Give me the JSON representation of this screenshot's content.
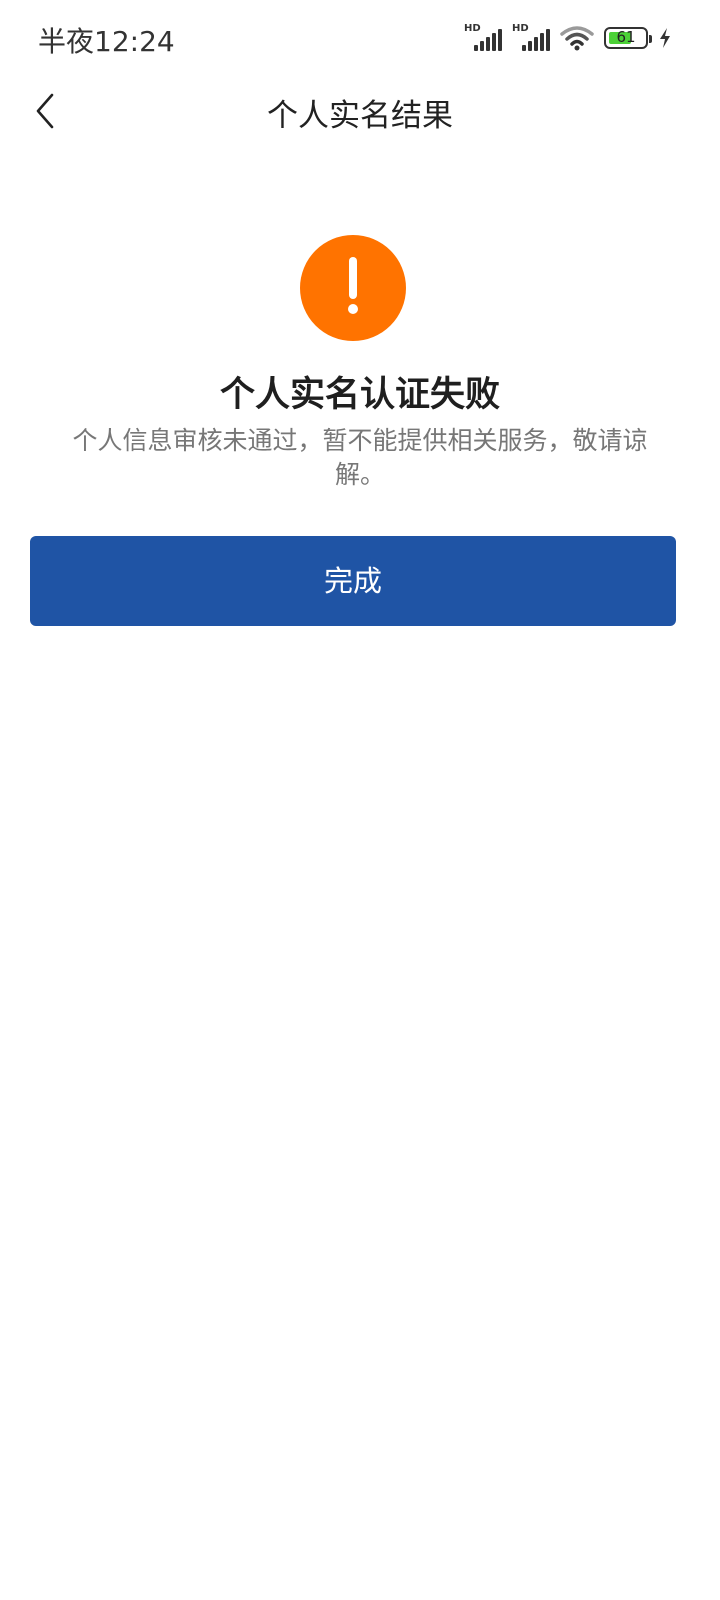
{
  "status_bar": {
    "time": "半夜12:24",
    "signal_1_label": "HD",
    "signal_2_label": "HD",
    "battery_level": "61",
    "icons": [
      "signal-icon",
      "signal-icon",
      "wifi-icon",
      "battery-icon",
      "charging-icon"
    ]
  },
  "nav": {
    "title": "个人实名结果",
    "back_icon": "chevron-left-icon"
  },
  "result": {
    "icon": "warning-icon",
    "title": "个人实名认证失败",
    "description": "个人信息审核未通过，暂不能提供相关服务，敬请谅解。"
  },
  "actions": {
    "done_label": "完成"
  },
  "colors": {
    "warning": "#ff7300",
    "primary_button": "#1f54a5",
    "battery_fill": "#4cd137"
  }
}
